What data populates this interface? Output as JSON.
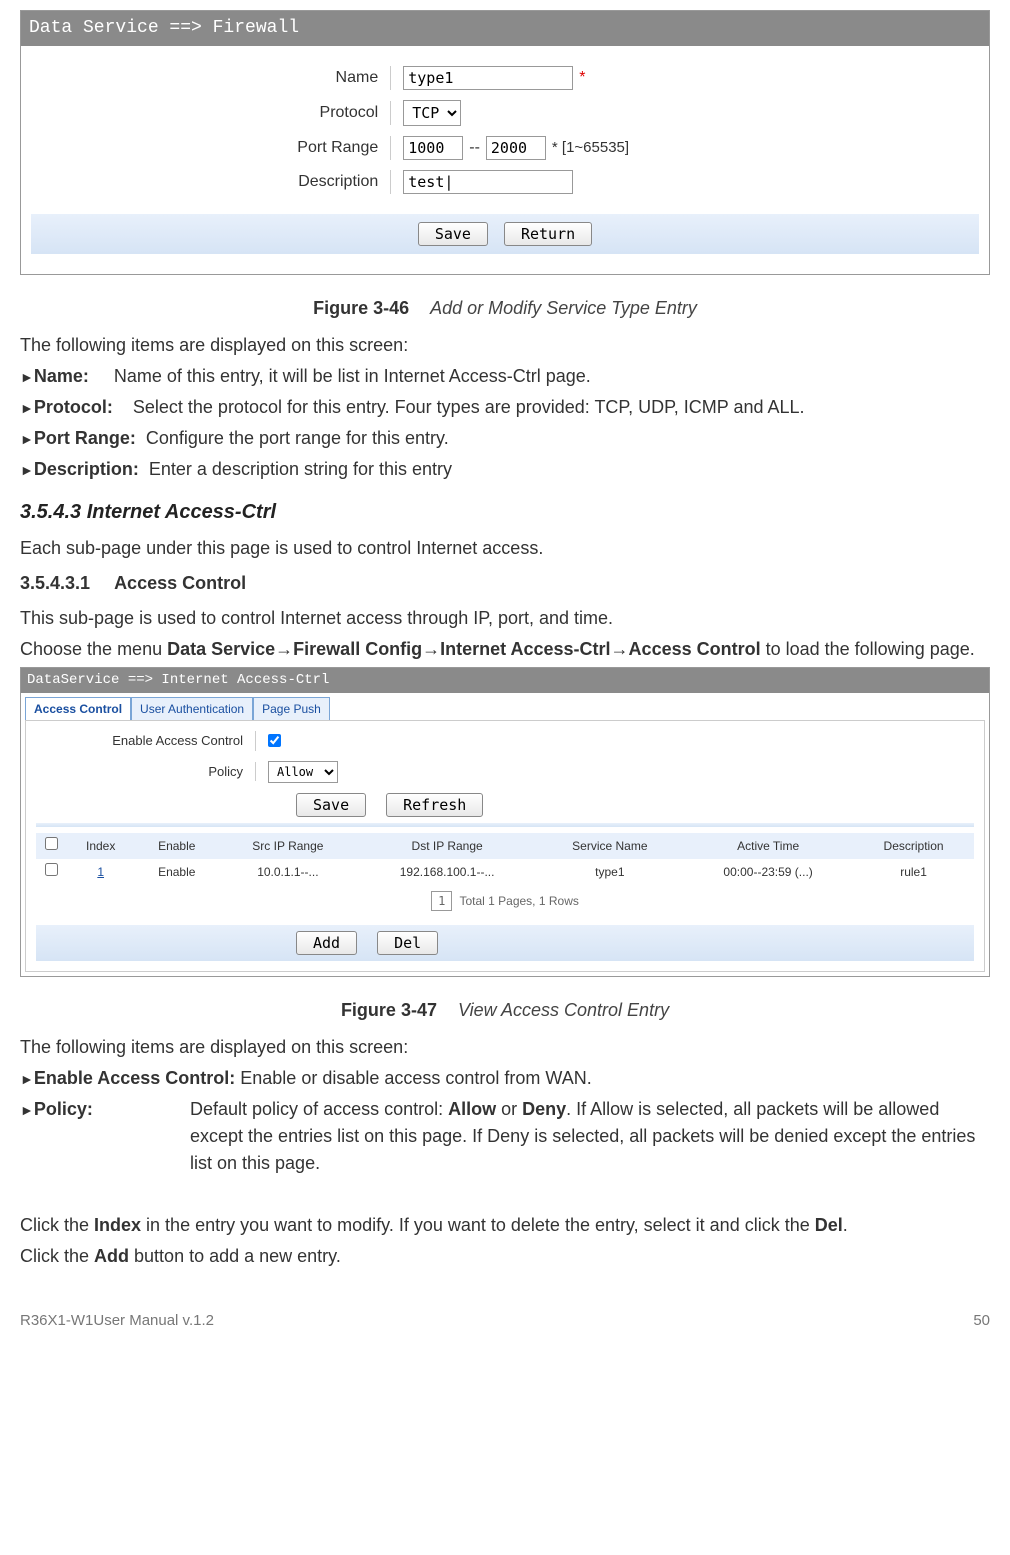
{
  "fig1": {
    "header": "Data Service ==> Firewall",
    "rows": {
      "name_label": "Name",
      "name_value": "type1",
      "protocol_label": "Protocol",
      "protocol_value": "TCP",
      "portrange_label": "Port Range",
      "port_from": "1000",
      "port_sep": "--",
      "port_to": "2000",
      "port_hint": "* [1~65535]",
      "desc_label": "Description",
      "desc_value": "test|"
    },
    "req": "*",
    "save": "Save",
    "return": "Return",
    "caption_num": "Figure 3-46",
    "caption_title": "Add or Modify Service Type Entry"
  },
  "text1": {
    "intro": "The following items are displayed on this screen:",
    "name_t": "Name:",
    "name_d": "Name of this entry, it will be list in Internet Access-Ctrl page.",
    "proto_t": "Protocol:",
    "proto_d": "Select the protocol for this entry. Four types are provided: TCP, UDP, ICMP and ALL.",
    "port_t": "Port Range:",
    "port_d": "Configure the port range for this entry.",
    "desc_t": "Description:",
    "desc_d": "Enter a description string for this entry"
  },
  "sec": {
    "h1": "3.5.4.3  Internet Access-Ctrl",
    "p1": "Each sub-page under this page is used to control Internet access.",
    "h2num": "3.5.4.3.1",
    "h2": "Access Control",
    "p2": "This sub-page is used to control Internet access through IP, port, and time.",
    "p3a": "Choose the menu ",
    "p3b": "Data Service→Firewall Config→Internet Access-Ctrl→Access Control",
    "p3c": " to load the following page."
  },
  "fig2": {
    "header": "DataService ==> Internet Access-Ctrl",
    "tabs": [
      "Access Control",
      "User Authentication",
      "Page Push"
    ],
    "enable_label": "Enable Access Control",
    "policy_label": "Policy",
    "policy_value": "Allow",
    "save": "Save",
    "refresh": "Refresh",
    "cols": [
      "",
      "Index",
      "Enable",
      "Src IP Range",
      "Dst IP Range",
      "Service Name",
      "Active Time",
      "Description"
    ],
    "row": {
      "index": "1",
      "enable": "Enable",
      "src": "10.0.1.1--...",
      "dst": "192.168.100.1--...",
      "svc": "type1",
      "time": "00:00--23:59 (...)",
      "desc": "rule1"
    },
    "pager_box": "1",
    "pager_text": "Total 1 Pages, 1 Rows",
    "add": "Add",
    "del": "Del",
    "caption_num": "Figure 3-47",
    "caption_title": "View Access Control Entry"
  },
  "text2": {
    "intro": "The following items are displayed on this screen:",
    "eac_t": "Enable Access Control:",
    "eac_d": "Enable or disable access control from WAN.",
    "pol_t": "Policy:",
    "pol_d1": "Default policy of access control: ",
    "pol_allow": "Allow",
    "pol_or": " or ",
    "pol_deny": "Deny",
    "pol_d2": ". If Allow is selected, all packets will be allowed except the entries list on this page. If Deny is selected, all packets will be denied except the entries list on this page.",
    "click1a": "Click the ",
    "click1b": "Index",
    "click1c": " in the entry you want to modify. If you want to delete the entry, select it and click the ",
    "click1d": "Del",
    "click1e": ".",
    "click2a": "Click the ",
    "click2b": "Add",
    "click2c": " button to add a new entry."
  },
  "footer": {
    "left": "R36X1-W1User Manual v.1.2",
    "right": "50"
  }
}
